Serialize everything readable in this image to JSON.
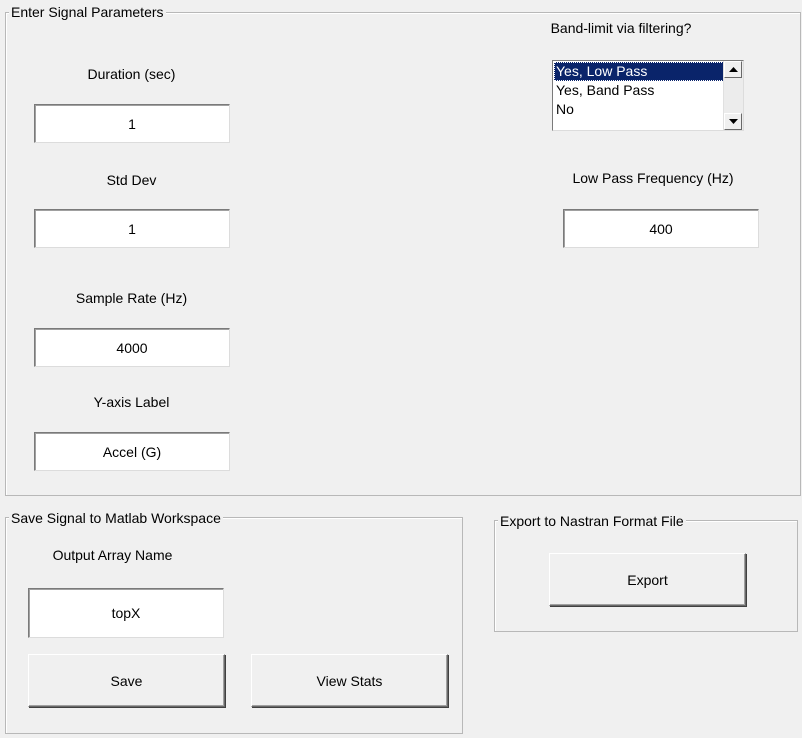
{
  "signal_params": {
    "title": "Enter Signal Parameters",
    "duration": {
      "label": "Duration (sec)",
      "value": "1"
    },
    "std_dev": {
      "label": "Std Dev",
      "value": "1"
    },
    "sample_rate": {
      "label": "Sample Rate (Hz)",
      "value": "4000"
    },
    "y_axis": {
      "label": "Y-axis Label",
      "value": "Accel (G)"
    },
    "bandlimit": {
      "label": "Band-limit via filtering?",
      "options": [
        "Yes, Low Pass",
        "Yes, Band Pass",
        "No"
      ],
      "selected": "Yes, Low Pass"
    },
    "low_pass": {
      "label": "Low Pass Frequency (Hz)",
      "value": "400"
    }
  },
  "save_panel": {
    "title": "Save Signal to Matlab Workspace",
    "output_label": "Output Array Name",
    "output_value": "topX",
    "save_label": "Save",
    "view_stats_label": "View Stats"
  },
  "export_panel": {
    "title": "Export to Nastran Format File",
    "export_label": "Export"
  }
}
